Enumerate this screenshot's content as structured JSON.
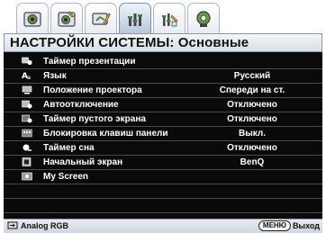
{
  "tabs": [
    {
      "icon": "picture-icon"
    },
    {
      "icon": "advanced-picture-icon"
    },
    {
      "icon": "display-icon"
    },
    {
      "icon": "system-setup-basic-icon",
      "active": true
    },
    {
      "icon": "system-setup-advanced-icon"
    },
    {
      "icon": "information-icon"
    }
  ],
  "title": "НАСТРОЙКИ СИСТЕМЫ: Основные",
  "menu": [
    {
      "label": "Таймер презентации",
      "value": "",
      "icon": "presentation-timer-icon"
    },
    {
      "label": "Язык",
      "value": "Русский",
      "icon": "language-icon"
    },
    {
      "label": "Положение проектора",
      "value": "Спереди на ст.",
      "icon": "projector-position-icon"
    },
    {
      "label": "Автоотключение",
      "value": "Отключено",
      "icon": "auto-off-icon"
    },
    {
      "label": "Таймер пустого экрана",
      "value": "Отключено",
      "icon": "blank-timer-icon"
    },
    {
      "label": "Блокировка клавиш панели",
      "value": "Выкл.",
      "icon": "panel-key-lock-icon"
    },
    {
      "label": "Таймер сна",
      "value": "Отключено",
      "icon": "sleep-timer-icon"
    },
    {
      "label": "Начальный экран",
      "value": "BenQ",
      "icon": "splash-screen-icon"
    },
    {
      "label": "My Screen",
      "value": "",
      "icon": "my-screen-icon"
    }
  ],
  "status": {
    "source": "Analog RGB",
    "menu_key": "МЕНЮ",
    "exit_label": "Выход"
  }
}
